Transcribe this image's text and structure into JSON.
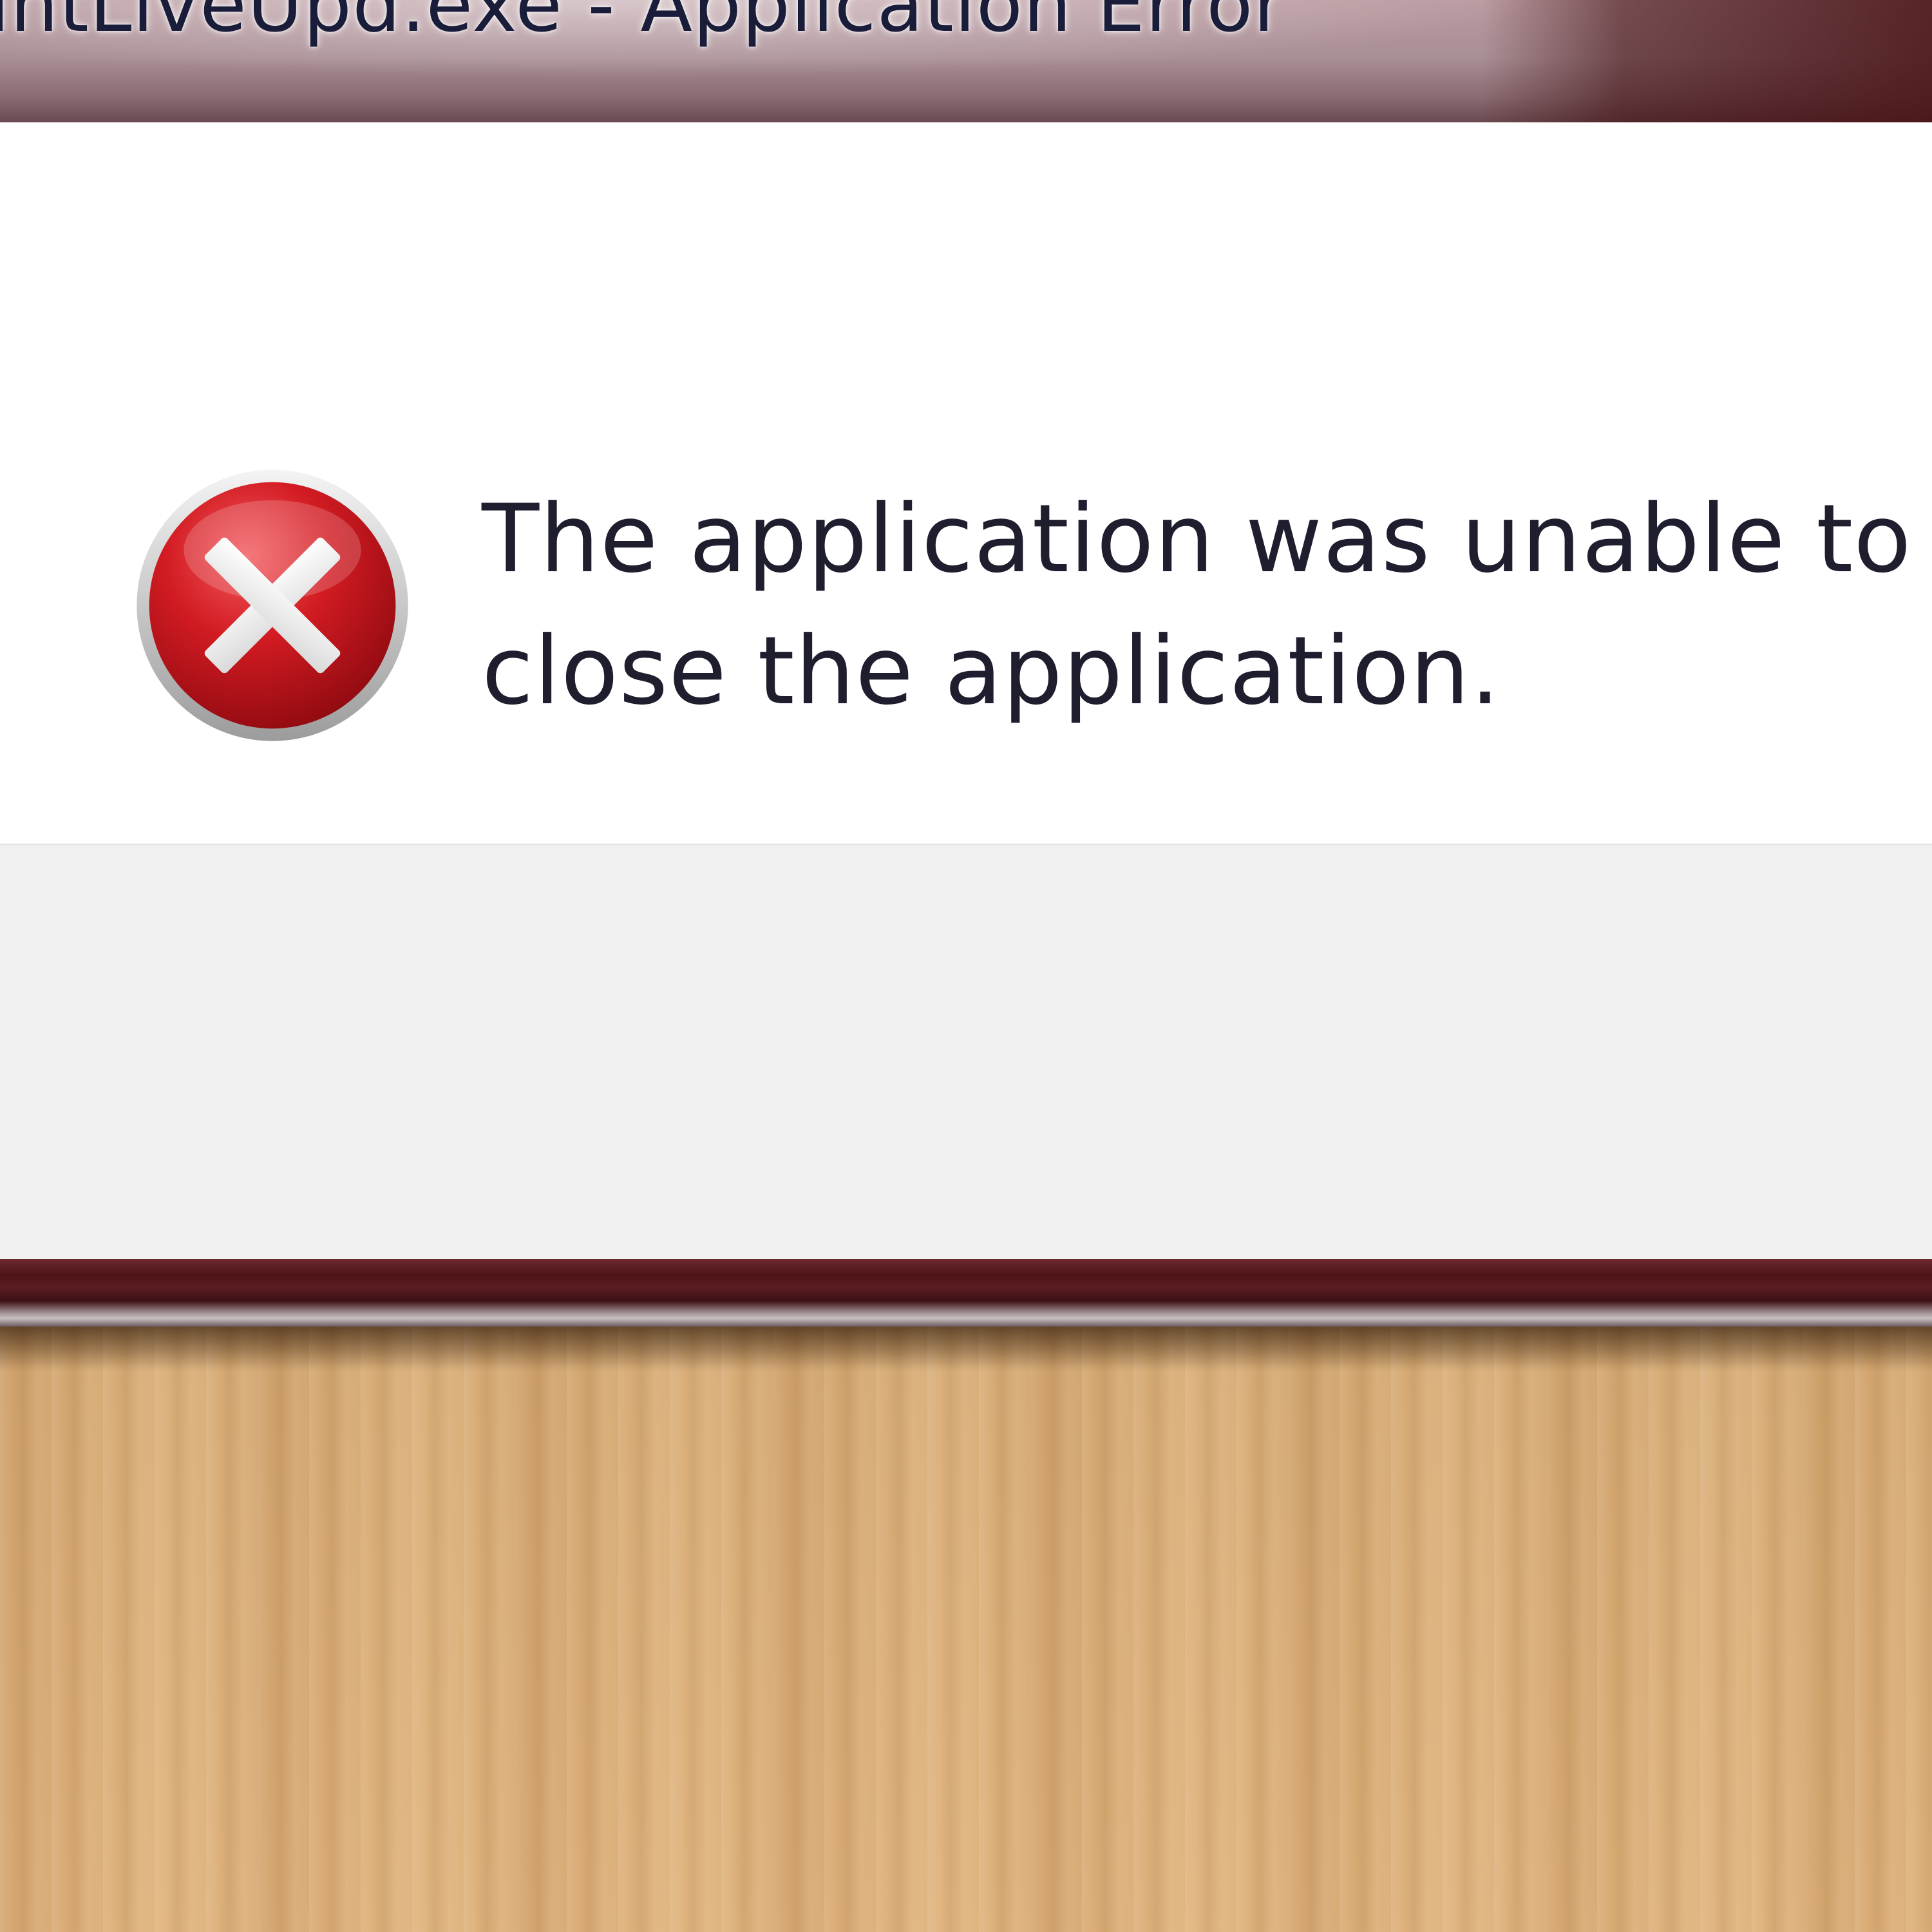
{
  "window": {
    "title": "untLiveUpd.exe - Application Error",
    "message_line1": "The application was unable to st",
    "message_line2": "close the application."
  },
  "icons": {
    "error": "error-x-icon"
  },
  "colors": {
    "titlebar_accent": "#4e1418",
    "error_red": "#c8161d",
    "content_bg": "#ffffff",
    "footer_bg": "#f0f0f0",
    "desktop_wood": "#ddb07a"
  }
}
